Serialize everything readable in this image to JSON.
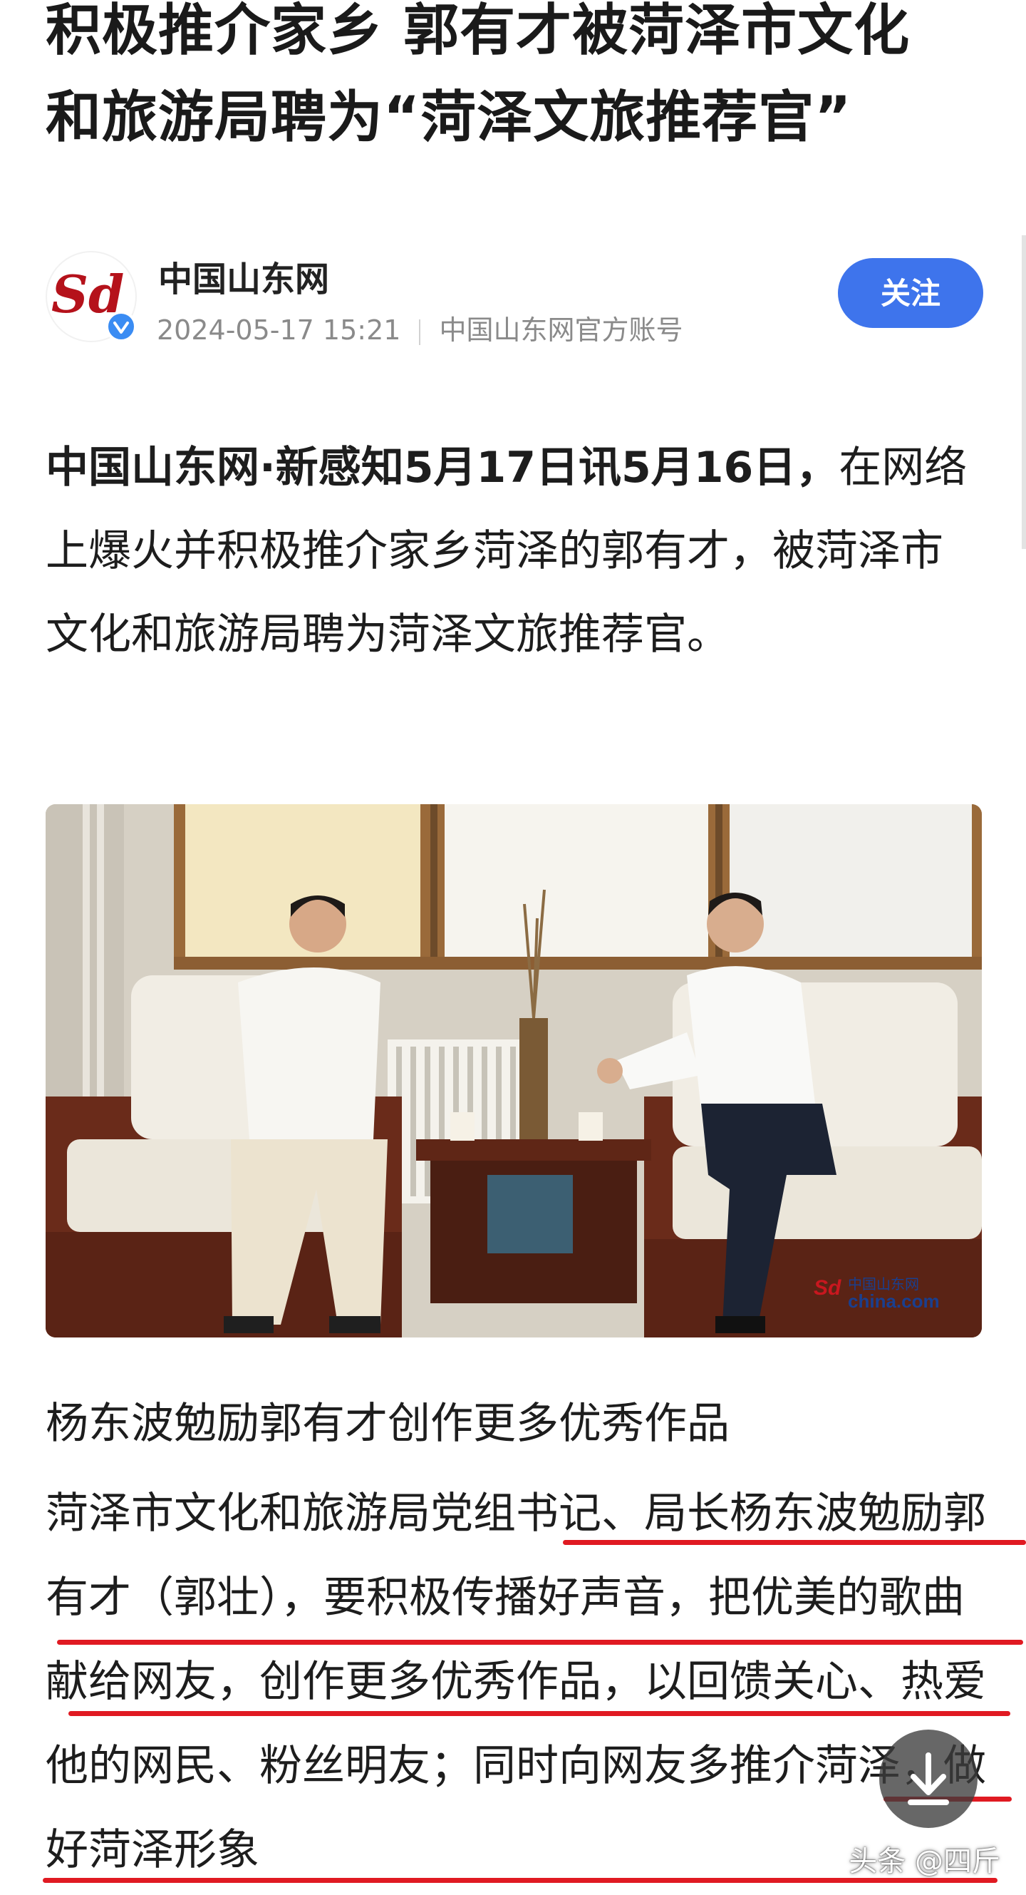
{
  "headline": {
    "line1": "积极推介家乡 郭有才被菏泽市文化",
    "line2": "和旅游局聘为“菏泽文旅推荐官”"
  },
  "author": {
    "name": "中国山东网",
    "date": "2024-05-17 15:21",
    "account_type": "中国山东网官方账号",
    "follow_label": "关注",
    "avatar_logo_text": "Sd"
  },
  "lead": {
    "bold_prefix": "中国山东网·新感知5月17日讯5月16日，",
    "text": "在网络上爆火并积极推介家乡菏泽的郭有才，被菏泽市文化和旅游局聘为菏泽文旅推荐官。"
  },
  "photo": {
    "icon": "news-photo",
    "watermark_brand": "中国山东网",
    "watermark_domain": "china.com"
  },
  "body": {
    "subheading": "杨东波勉励郭有才创作更多优秀作品",
    "paragraph": "菏泽市文化和旅游局党组书记、局长杨东波勉励郭有才（郭壮），要积极传播好声音，把优美的歌曲献给网友，创作更多优秀作品，以回馈关心、热爱他的网民、粉丝明友；同时向网友多推介菏泽，做好菏泽形象"
  },
  "overlay": {
    "download_icon": "download-icon",
    "watermark_text": "头条 @四斤"
  },
  "colors": {
    "accent_blue": "#3e74ec",
    "highlight_red": "#e01a22"
  }
}
